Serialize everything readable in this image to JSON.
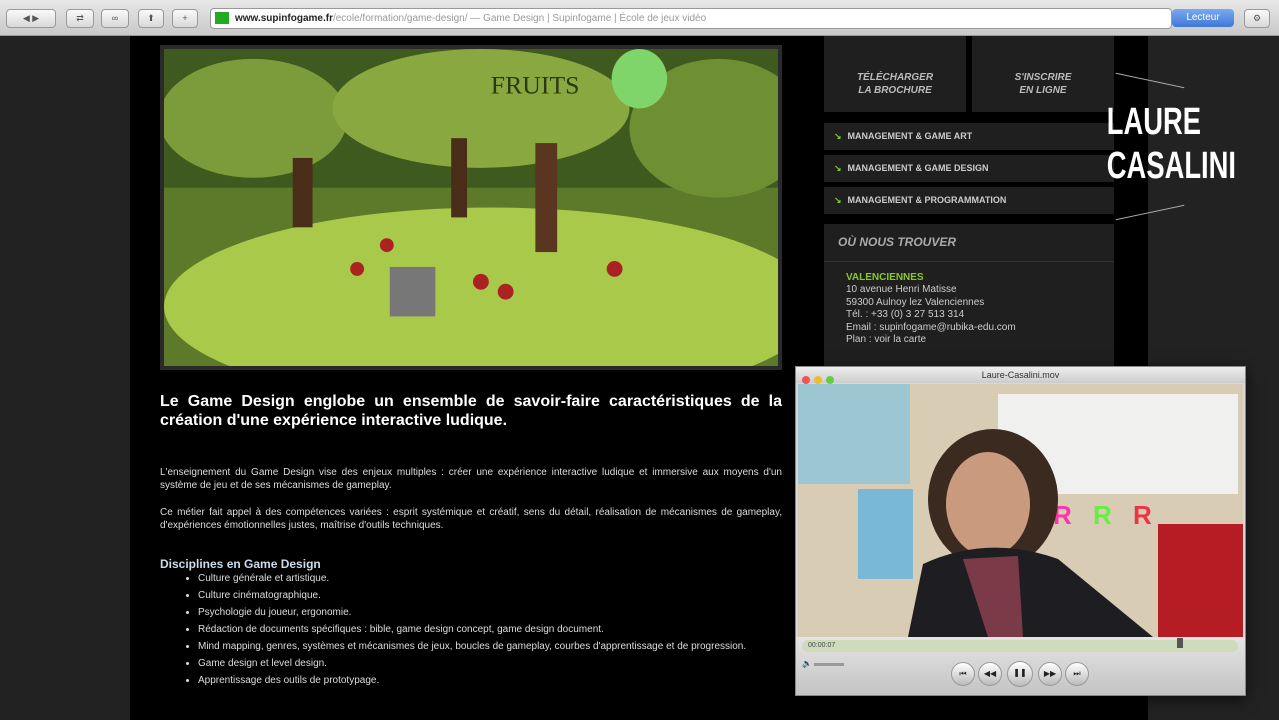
{
  "browser": {
    "url_domain": "www.supinfogame.fr",
    "url_path": "/ecole/formation/game-design/ — Game Design | Supinfogame | École de jeux vidéo",
    "reader_label": "Lecteur",
    "buttons": [
      "◀ ▶",
      "⇄",
      "∞",
      "⬆",
      "+"
    ]
  },
  "game_image": {
    "sign_text": "FRUITS"
  },
  "main": {
    "lead": "Le Game Design englobe un ensemble de savoir-faire caractéristiques de la création d'une expérience interactive ludique.",
    "para1": "L'enseignement du Game Design vise des enjeux multiples : créer une expérience interactive ludique et immersive aux moyens d'un système de jeu et de ses mécanismes de gameplay.",
    "para2": "Ce métier fait appel à des compétences variées : esprit systémique et créatif, sens du détail, réalisation de mécanismes de gameplay, d'expériences émotionnelles justes, maîtrise d'outils techniques.",
    "disciplines_title": "Disciplines en Game Design",
    "disciplines": [
      "Culture générale et artistique.",
      "Culture cinématographique.",
      "Psychologie du joueur, ergonomie.",
      "Rédaction de documents spécifiques : bible, game design concept, game design document.",
      "Mind mapping, genres, systèmes et mécanismes de jeux, boucles de gameplay, courbes d'apprentissage et de progression.",
      "Game design et level design.",
      "Apprentissage des outils de prototypage."
    ]
  },
  "sidebar": {
    "cta": [
      {
        "label1": "TÉLÉCHARGER",
        "label2": "LA BROCHURE"
      },
      {
        "label1": "S'INSCRIRE",
        "label2": "EN LIGNE"
      }
    ],
    "menu": [
      "MANAGEMENT & GAME ART",
      "MANAGEMENT & GAME DESIGN",
      "MANAGEMENT & PROGRAMMATION"
    ],
    "location": {
      "title": "OÙ NOUS TROUVER",
      "city": "VALENCIENNES",
      "address1": "10 avenue Henri Matisse",
      "address2": "59300 Aulnoy lez Valenciennes",
      "tel": "Tél. : +33 (0) 3 27 513 314",
      "email": "Email : supinfogame@rubika-edu.com",
      "plan": "Plan : voir la carte"
    }
  },
  "overlay_name": {
    "first": "LAURE",
    "last": "CASALINI"
  },
  "video": {
    "title": "Laure-Casalini.mov",
    "time": "00:00:07",
    "progress": 0.86
  }
}
